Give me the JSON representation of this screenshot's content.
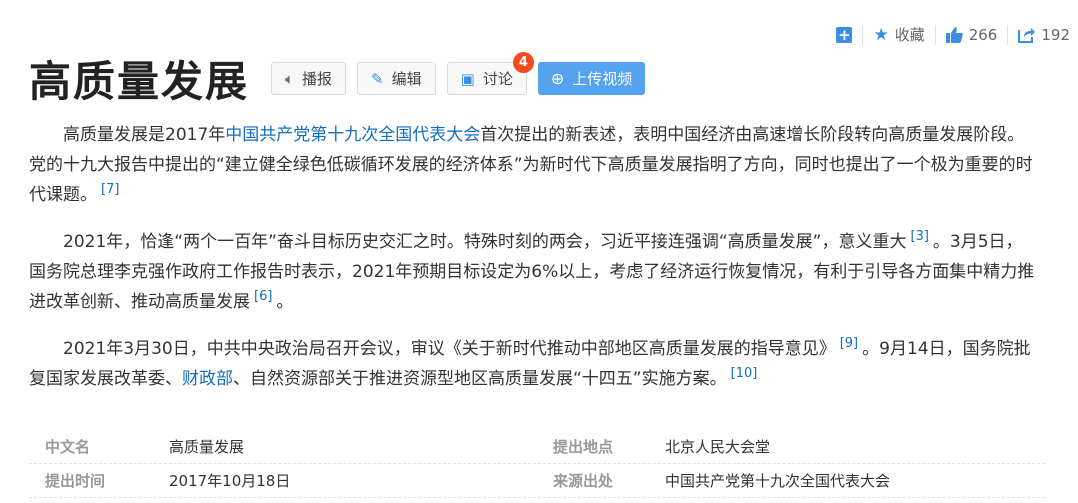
{
  "toolbar": {
    "add_icon": "plus-square-icon",
    "collect_label": "收藏",
    "like_count": "266",
    "share_count": "192"
  },
  "title": "高质量发展",
  "buttons": {
    "play": "播报",
    "edit": "编辑",
    "discuss": "讨论",
    "discuss_badge": "4",
    "upload": "上传视频"
  },
  "paragraphs": {
    "p1": {
      "a": "高质量发展是2017年",
      "link": "中国共产党第十九次全国代表大会",
      "b": "首次提出的新表述，表明中国经济由高速增长阶段转向高质量发展阶段。党的十九大报告中提出的“建立健全绿色低碳循环发展的经济体系”为新时代下高质量发展指明了方向，同时也提出了一个极为重要的时代课题。",
      "ref": "[7]"
    },
    "p2": {
      "a": "2021年，恰逢“两个一百年”奋斗目标历史交汇之时。特殊时刻的两会，习近平接连强调“高质量发展”，意义重大",
      "ref1": "[3]",
      "b": "。3月5日，国务院总理李克强作政府工作报告时表示，2021年预期目标设定为6%以上，考虑了经济运行恢复情况，有利于引导各方面集中精力推进改革创新、推动高质量发展",
      "ref2": "[6]",
      "c": "。"
    },
    "p3": {
      "a": "2021年3月30日，中共中央政治局召开会议，审议《关于新时代推动中部地区高质量发展的指导意见》",
      "ref1": "[9]",
      "b": "。9月14日，国务院批复国家发展改革委、",
      "link": "财政部",
      "c": "、自然资源部关于推进资源型地区高质量发展“十四五”实施方案。",
      "ref2": "[10]"
    }
  },
  "info": [
    {
      "k1": "中文名",
      "v1": "高质量发展",
      "k2": "提出地点",
      "v2": "北京人民大会堂"
    },
    {
      "k1": "提出时间",
      "v1": "2017年10月18日",
      "k2": "来源出处",
      "v2": "中国共产党第十九次全国代表大会"
    }
  ]
}
